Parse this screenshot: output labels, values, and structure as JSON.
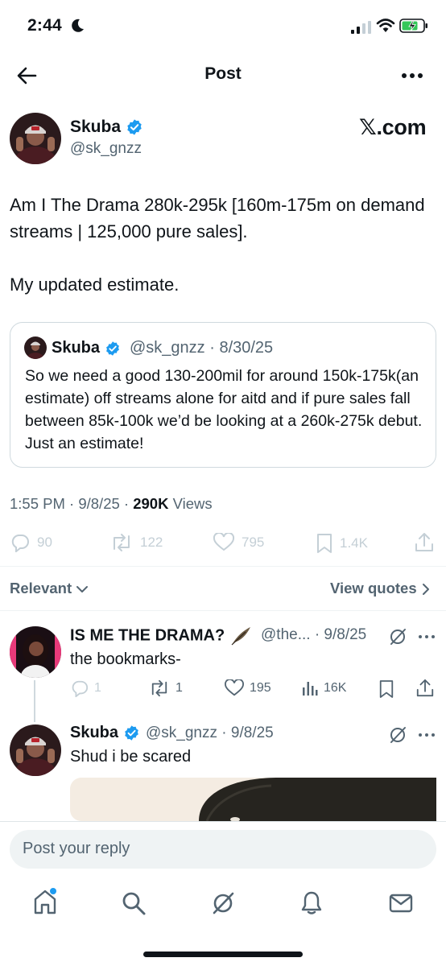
{
  "status_bar": {
    "time": "2:44",
    "moon_icon": "moon-icon",
    "signal_icon": "cellular-signal-icon",
    "wifi_icon": "wifi-icon",
    "battery_icon": "battery-charging-icon",
    "battery_color": "#34c759"
  },
  "nav": {
    "title": "Post",
    "back_icon": "back-arrow-icon",
    "more_icon": "more-dots-icon"
  },
  "post": {
    "author_name": "Skuba",
    "author_handle": "@sk_gnzz",
    "source": "𝕏.com",
    "text": "Am I The Drama 280k-295k [160m-175m on demand streams | 125,000 pure sales].\n\nMy updated estimate.",
    "quote": {
      "name": "Skuba",
      "meta": "@sk_gnzz · 8/30/25",
      "text": "So we need a good 130-200mil for around 150k-175k(an estimate) off streams alone for aitd and if pure sales fall between  85k-100k we’d be looking at a 260k-275k debut. Just an estimate!"
    },
    "timestamp": "1:55 PM · 9/8/25 · ",
    "views_count": "290K",
    "views_label": " Views",
    "stats": {
      "replies": "90",
      "reposts": "122",
      "likes": "795",
      "bookmarks": "1.4K"
    }
  },
  "sort": {
    "label": "Relevant",
    "view_quotes": "View quotes"
  },
  "replies": [
    {
      "name": "IS ME THE DRAMA?",
      "meta": "@the... · 9/8/25",
      "text": "the bookmarks-",
      "stats": {
        "replies": "1",
        "reposts": "1",
        "likes": "195",
        "views": "16K"
      }
    },
    {
      "name": "Skuba",
      "meta": "@sk_gnzz · 9/8/25",
      "text": "Shud i be scared"
    }
  ],
  "composer": {
    "placeholder": "Post your reply"
  },
  "tabbar": {
    "items": [
      "home-icon",
      "search-icon",
      "grok-icon",
      "notifications-icon",
      "messages-icon"
    ]
  },
  "colors": {
    "verified": "#1d9bf0",
    "muted": "#536471",
    "border": "#cfd9de"
  }
}
